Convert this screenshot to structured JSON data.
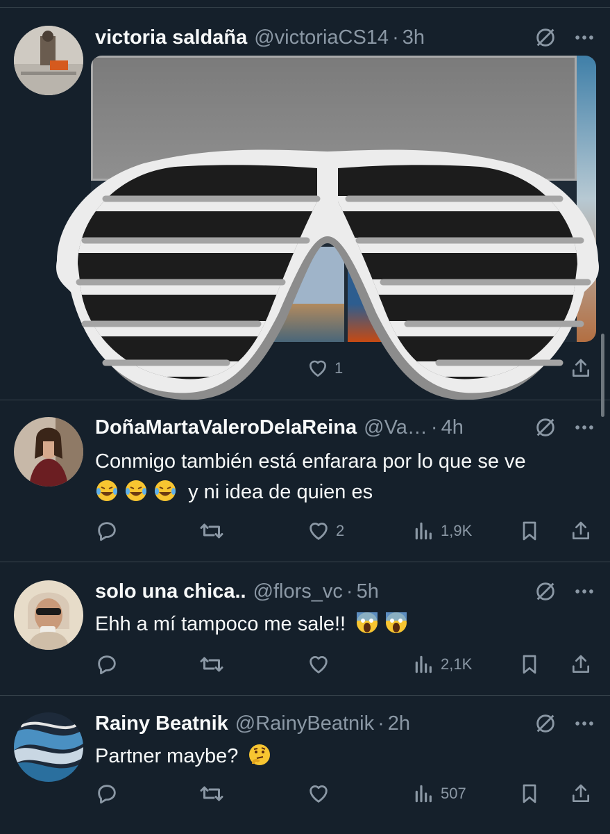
{
  "tweets": [
    {
      "name": "victoria saldaña",
      "handle": "@victoriaCS14",
      "time": "3h",
      "text": "",
      "likes": "1"
    },
    {
      "name": "DoñaMartaValeroDelaReina",
      "handle": "@Va…",
      "time": "4h",
      "text_line1": "Conmigo también está enfarara por lo que se ve",
      "text_line2": "y ni idea de quien es",
      "likes": "2",
      "views": "1,9K"
    },
    {
      "name": "solo una chica..",
      "handle": "@flors_vc",
      "time": "5h",
      "text": "Ehh a mí tampoco me sale!!",
      "views": "2,1K"
    },
    {
      "name": "Rainy Beatnik",
      "handle": "@RainyBeatnik",
      "time": "2h",
      "text": "Partner maybe?",
      "views": "507"
    }
  ],
  "separator": "·",
  "icons": {
    "grok": "slashed-circle-icon",
    "more": "more-dots-icon",
    "reply": "reply-icon",
    "retweet": "retweet-icon",
    "like": "heart-icon",
    "views": "views-icon",
    "bookmark": "bookmark-icon",
    "share": "share-icon",
    "overlay": "shutter-shades-sticker"
  },
  "colors": {
    "background": "#15202b",
    "text": "#f7f9f9",
    "muted": "#8b98a5",
    "divider": "#38444d"
  }
}
